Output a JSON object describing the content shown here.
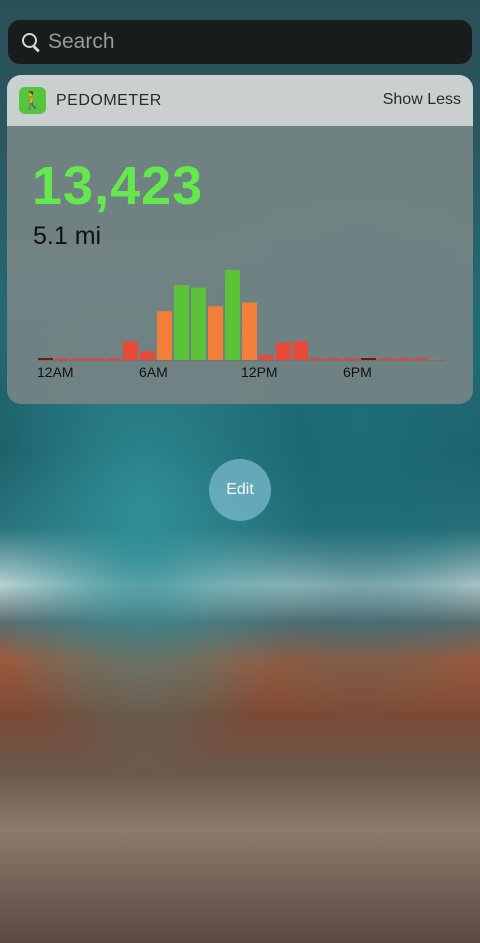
{
  "search": {
    "placeholder": "Search"
  },
  "widget": {
    "app_name": "PEDOMETER",
    "app_icon": "walking-person-icon",
    "toggle_label": "Show Less",
    "steps": "13,423",
    "distance": "5.1 mi"
  },
  "chart_data": {
    "type": "bar",
    "categories": [
      "0",
      "1",
      "2",
      "3",
      "4",
      "5",
      "6",
      "7",
      "8",
      "9",
      "10",
      "11",
      "12",
      "13",
      "14",
      "15",
      "16",
      "17",
      "18",
      "19",
      "20",
      "21",
      "22",
      "23"
    ],
    "values": [
      1,
      0.5,
      0.5,
      0.5,
      0.5,
      15,
      7,
      39,
      60,
      58,
      43,
      72,
      46,
      4,
      14,
      15,
      0.5,
      0.5,
      0.5,
      1,
      0.5,
      0.5,
      0.5,
      0.5
    ],
    "colors": [
      "#6b1a14",
      "#d94a3c",
      "#d94a3c",
      "#d94a3c",
      "#d94a3c",
      "#e84a3a",
      "#e84a3a",
      "#f27f3a",
      "#5cc23a",
      "#5cc23a",
      "#f27f3a",
      "#5cc23a",
      "#f27f3a",
      "#e84a3a",
      "#e84a3a",
      "#e84a3a",
      "#d94a3c",
      "#d94a3c",
      "#d94a3c",
      "#6b1a14",
      "#d94a3c",
      "#d94a3c",
      "#d94a3c",
      "#8a7a7a"
    ],
    "tick_labels": [
      "12AM",
      "6AM",
      "12PM",
      "6PM"
    ],
    "tick_positions": [
      0,
      6,
      12,
      18
    ],
    "ylim": [
      0,
      80
    ]
  },
  "edit_label": "Edit"
}
